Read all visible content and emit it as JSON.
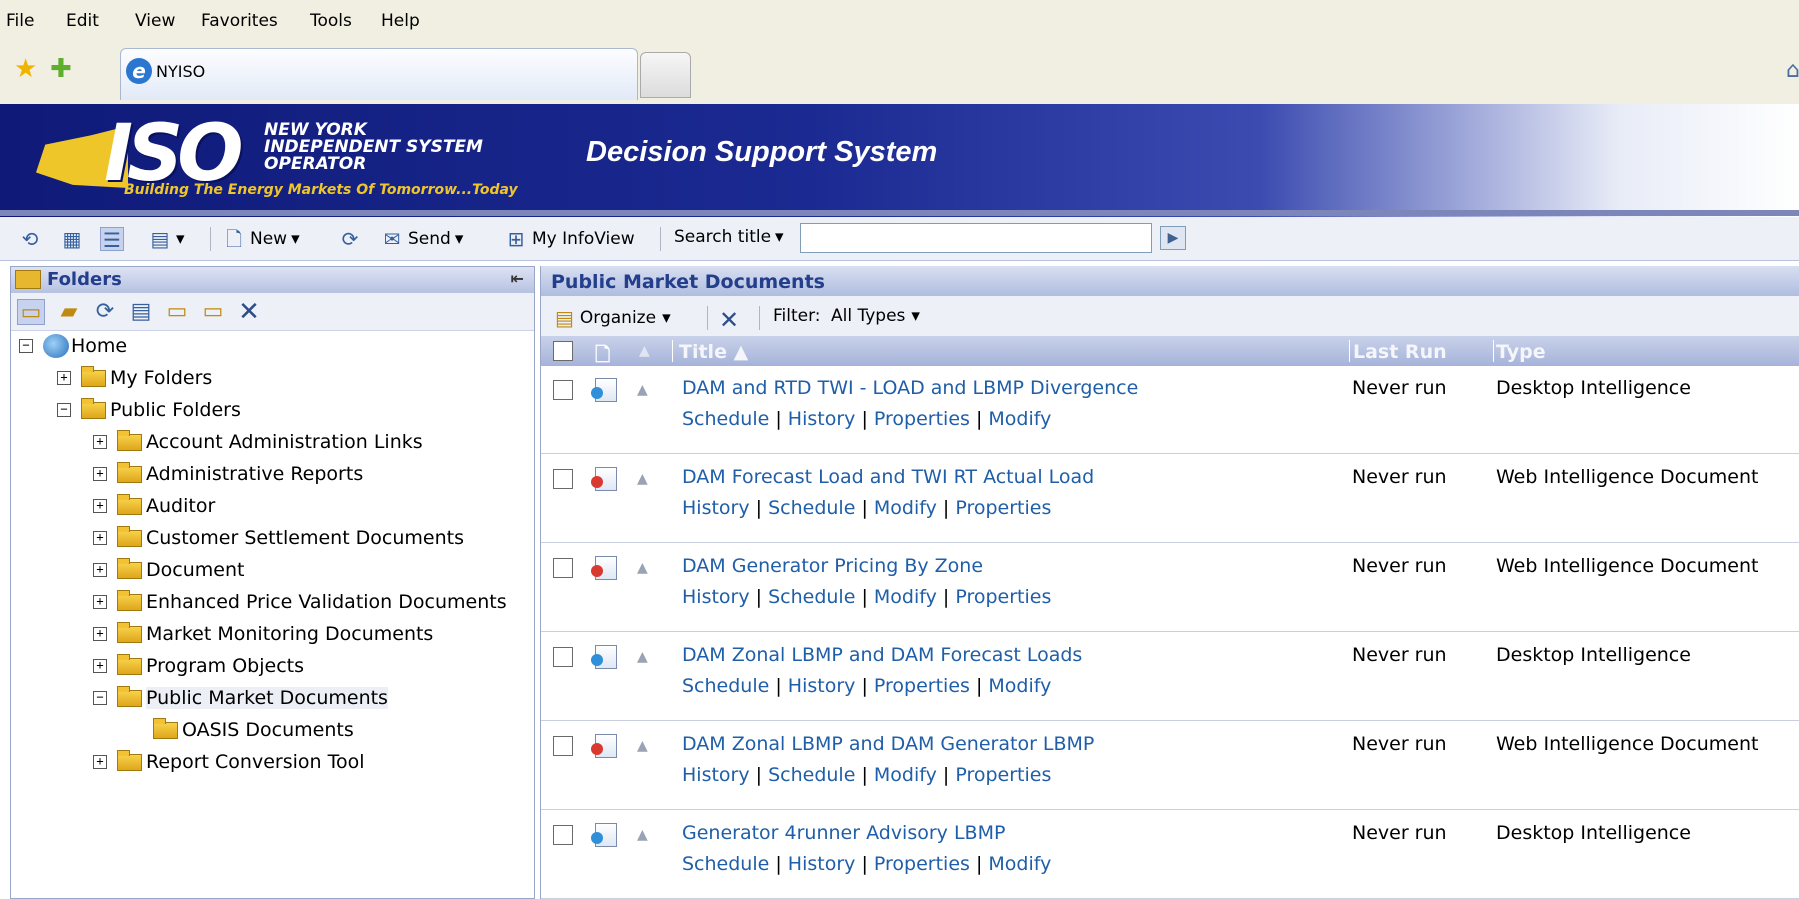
{
  "menu": [
    "File",
    "Edit",
    "View",
    "Favorites",
    "Tools",
    "Help"
  ],
  "browser": {
    "tab_title": "NYISO"
  },
  "banner": {
    "logo_text": "ISO",
    "org_name": "NEW YORK INDEPENDENT SYSTEM OPERATOR",
    "tagline": "Building The Energy Markets Of Tomorrow...Today",
    "app_title": "Decision Support System"
  },
  "toolbar": {
    "new_label": "New",
    "send_label": "Send",
    "myinfoview_label": "My InfoView",
    "search_mode": "Search title",
    "search_value": ""
  },
  "left_panel": {
    "title": "Folders",
    "tree": [
      {
        "label": "Home",
        "toggle": "−"
      },
      {
        "label": "My Folders",
        "toggle": "+"
      },
      {
        "label": "Public Folders",
        "toggle": "−"
      },
      {
        "label": "Account Administration Links",
        "toggle": "+"
      },
      {
        "label": "Administrative Reports",
        "toggle": "+"
      },
      {
        "label": "Auditor",
        "toggle": "+"
      },
      {
        "label": "Customer Settlement Documents",
        "toggle": "+"
      },
      {
        "label": "Document",
        "toggle": "+"
      },
      {
        "label": "Enhanced Price Validation Documents",
        "toggle": "+"
      },
      {
        "label": "Market Monitoring Documents",
        "toggle": "+"
      },
      {
        "label": "Program Objects",
        "toggle": "+"
      },
      {
        "label": "Public Market Documents",
        "toggle": "−"
      },
      {
        "label": "OASIS Documents",
        "toggle": ""
      },
      {
        "label": "Report Conversion Tool",
        "toggle": "+"
      }
    ]
  },
  "main": {
    "title": "Public Market Documents",
    "organize_label": "Organize",
    "filter_label": "Filter:",
    "filter_value": "All Types",
    "columns": {
      "title": "Title ▲",
      "last_run": "Last Run",
      "type": "Type"
    },
    "rows": [
      {
        "title": "DAM and RTD TWI - LOAD and LBMP Divergence",
        "links": [
          "Schedule",
          "History",
          "Properties",
          "Modify"
        ],
        "last_run": "Never run",
        "type": "Desktop Intelligence",
        "dot_color": "#2f8fd8"
      },
      {
        "title": "DAM Forecast Load and TWI RT Actual Load",
        "links": [
          "History",
          "Schedule",
          "Modify",
          "Properties"
        ],
        "last_run": "Never run",
        "type": "Web Intelligence Document",
        "dot_color": "#d83a2f"
      },
      {
        "title": "DAM Generator Pricing By Zone",
        "links": [
          "History",
          "Schedule",
          "Modify",
          "Properties"
        ],
        "last_run": "Never run",
        "type": "Web Intelligence Document",
        "dot_color": "#d83a2f"
      },
      {
        "title": "DAM Zonal LBMP and DAM Forecast Loads",
        "links": [
          "Schedule",
          "History",
          "Properties",
          "Modify"
        ],
        "last_run": "Never run",
        "type": "Desktop Intelligence",
        "dot_color": "#2f8fd8"
      },
      {
        "title": "DAM Zonal LBMP and DAM Generator LBMP",
        "links": [
          "History",
          "Schedule",
          "Modify",
          "Properties"
        ],
        "last_run": "Never run",
        "type": "Web Intelligence Document",
        "dot_color": "#d83a2f"
      },
      {
        "title": "Generator 4runner Advisory LBMP",
        "links": [
          "Schedule",
          "History",
          "Properties",
          "Modify"
        ],
        "last_run": "Never run",
        "type": "Desktop Intelligence",
        "dot_color": "#2f8fd8"
      }
    ]
  }
}
